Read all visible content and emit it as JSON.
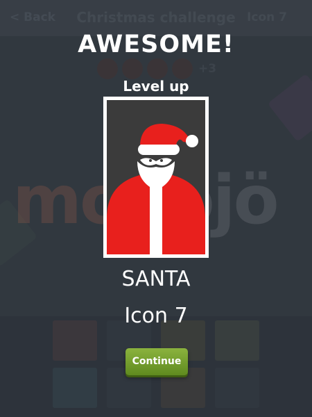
{
  "background": {
    "back_label": "< Back",
    "title": "Christmas challenge",
    "icon_label": "Icon 7",
    "extra_count": "+3",
    "watermark_a": "mod",
    "watermark_b": "ojö"
  },
  "dialog": {
    "headline": "AWESOME!",
    "subtitle": "Level up",
    "icon_name": "SANTA",
    "icon_number": "Icon 7",
    "continue_label": "Continue"
  },
  "icon": {
    "name": "santa-icon",
    "background_color": "#3b3b3b",
    "suit_color": "#e8201d",
    "trim_color": "#ffffff"
  },
  "colors": {
    "button_green": "#76a02e",
    "text": "#ffffff"
  }
}
